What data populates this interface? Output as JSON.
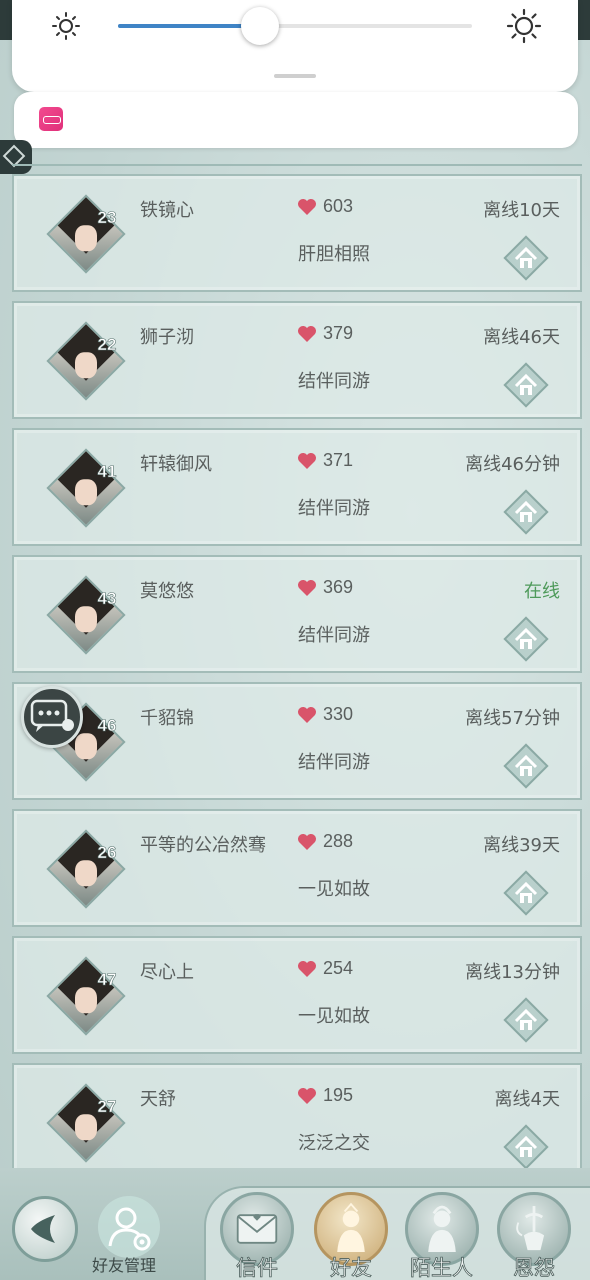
{
  "quick_settings": {
    "brightness_level": 0.4,
    "brightness_min_icon": "sun-dim-icon",
    "brightness_max_icon": "sun-bright-icon",
    "accent_color": "#3f84c6"
  },
  "notification": {
    "app_icon": "bilibili-icon"
  },
  "friends": [
    {
      "name": "铁镜心",
      "level": "23",
      "intimacy": "603",
      "relation": "肝胆相照",
      "status": "离线10天",
      "online": false
    },
    {
      "name": "狮子沏",
      "level": "22",
      "intimacy": "379",
      "relation": "结伴同游",
      "status": "离线46天",
      "online": false
    },
    {
      "name": "轩辕御风",
      "level": "41",
      "intimacy": "371",
      "relation": "结伴同游",
      "status": "离线46分钟",
      "online": false
    },
    {
      "name": "莫悠悠",
      "level": "43",
      "intimacy": "369",
      "relation": "结伴同游",
      "status": "在线",
      "online": true
    },
    {
      "name": "千貂锦",
      "level": "46",
      "intimacy": "330",
      "relation": "结伴同游",
      "status": "离线57分钟",
      "online": false
    },
    {
      "name": "平等的公冶然骞",
      "level": "26",
      "intimacy": "288",
      "relation": "一见如故",
      "status": "离线39天",
      "online": false
    },
    {
      "name": "尽心上",
      "level": "47",
      "intimacy": "254",
      "relation": "一见如故",
      "status": "离线13分钟",
      "online": false
    },
    {
      "name": "天舒",
      "level": "27",
      "intimacy": "195",
      "relation": "泛泛之交",
      "status": "离线4天",
      "online": false
    }
  ],
  "colors": {
    "heart": "#d9546a",
    "online": "#4e9a5a",
    "text": "#5a5f5e"
  },
  "bottom_bar": {
    "manage_label": "好友管理",
    "tabs": [
      {
        "label": "信件",
        "icon": "mail-icon",
        "active": false
      },
      {
        "label": "好友",
        "icon": "friend-portrait-icon",
        "active": true
      },
      {
        "label": "陌生人",
        "icon": "stranger-portrait-icon",
        "active": false
      },
      {
        "label": "恩怨",
        "icon": "hookah-icon",
        "active": false
      }
    ]
  }
}
